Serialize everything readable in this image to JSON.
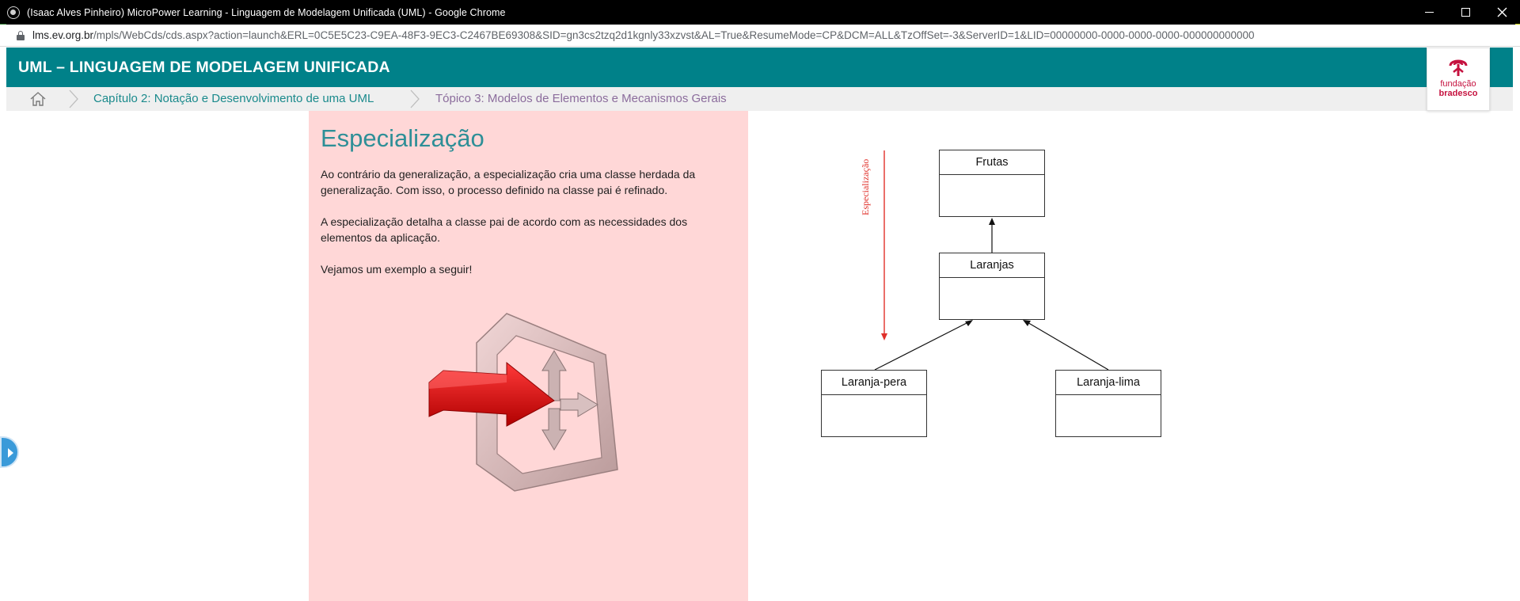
{
  "browser": {
    "window_title": "(Isaac Alves Pinheiro) MicroPower Learning - Linguagem de Modelagem Unificada (UML) - Google Chrome",
    "url_host": "lms.ev.org.br",
    "url_path": "/mpls/WebCds/cds.aspx?action=launch&ERL=0C5E5C23-C9EA-48F3-9EC3-C2467BE69308&SID=gn3cs2tzq2d1kgnly33xzvst&AL=True&ResumeMode=CP&DCM=ALL&TzOffSet=-3&ServerID=1&LID=00000000-0000-0000-0000-000000000000"
  },
  "header": {
    "title": "UML – LINGUAGEM DE MODELAGEM UNIFICADA",
    "logo_line1": "fundação",
    "logo_line2": "bradesco",
    "brand_color": "#008189",
    "logo_color": "#c5123f"
  },
  "breadcrumb": {
    "home_icon": "home-icon",
    "chapter": "Capítulo 2: Notação e Desenvolvimento de uma UML",
    "topic": "Tópico 3: Modelos de Elementos e Mecanismos Gerais"
  },
  "content": {
    "heading": "Especialização",
    "paragraph1": "Ao contrário da generalização, a especialização cria uma classe herdada da generalização. Com isso, o processo definido na classe pai é refinado.",
    "paragraph2": "A especialização detalha a classe pai de acordo com as necessidades dos elementos da aplicação.",
    "paragraph3": "Vejamos um exemplo a seguir!",
    "panel_color": "#ffd7d7"
  },
  "diagram": {
    "arrow_label": "Especialização",
    "classes": {
      "root": "Frutas",
      "middle": "Laranjas",
      "left_child": "Laranja-pera",
      "right_child": "Laranja-lima"
    },
    "arrow_color": "#e0302a"
  }
}
